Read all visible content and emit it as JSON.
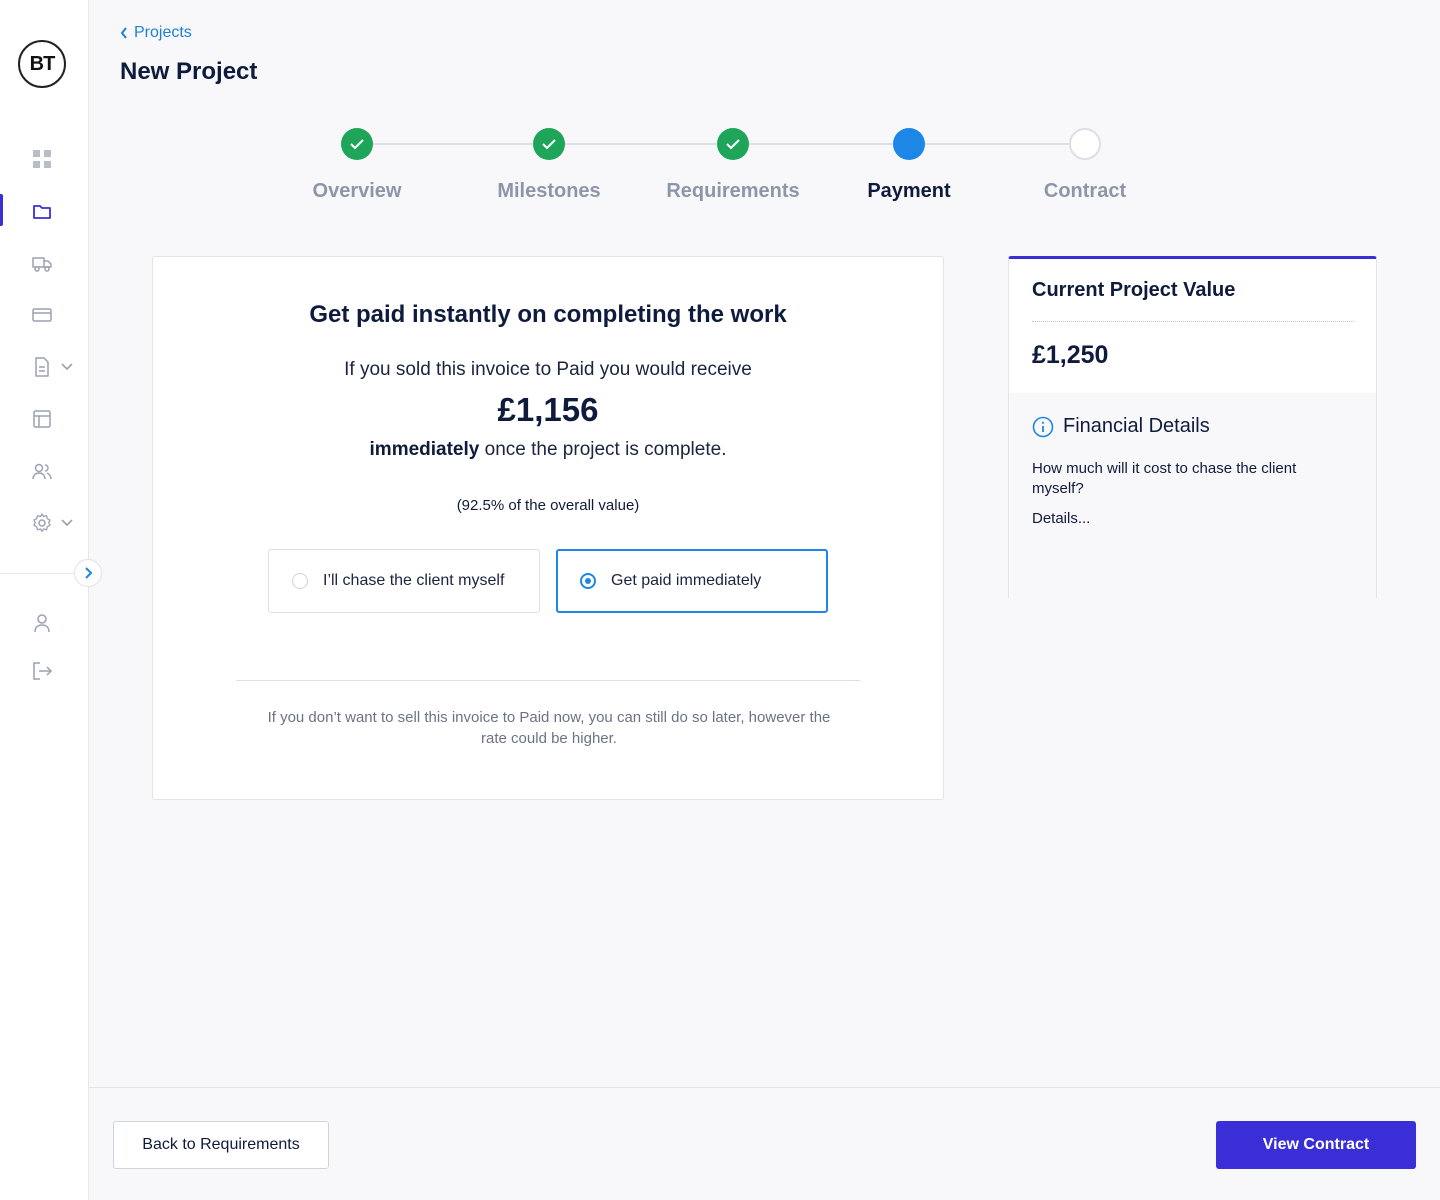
{
  "brand": {
    "logo_text": "BT",
    "accent": "#3a2fd6",
    "link": "#1d7fd6",
    "success": "#1fa55a",
    "progress": "#1d86e6"
  },
  "sidebar": {
    "items": [
      {
        "name": "dashboard",
        "icon": "grid-icon"
      },
      {
        "name": "projects",
        "icon": "folder-icon",
        "active": true
      },
      {
        "name": "delivery",
        "icon": "truck-icon"
      },
      {
        "name": "payments",
        "icon": "card-icon"
      },
      {
        "name": "documents",
        "icon": "document-icon",
        "expandable": true
      },
      {
        "name": "layout",
        "icon": "layout-icon"
      },
      {
        "name": "contacts",
        "icon": "users-icon"
      },
      {
        "name": "settings",
        "icon": "gear-icon",
        "expandable": true
      },
      {
        "name": "profile",
        "icon": "user-icon"
      },
      {
        "name": "logout",
        "icon": "logout-icon"
      }
    ]
  },
  "header": {
    "breadcrumb": "Projects",
    "title": "New Project"
  },
  "stepper": {
    "steps": [
      {
        "label": "Overview",
        "state": "done"
      },
      {
        "label": "Milestones",
        "state": "done"
      },
      {
        "label": "Requirements",
        "state": "done"
      },
      {
        "label": "Payment",
        "state": "current"
      },
      {
        "label": "Contract",
        "state": "todo"
      }
    ]
  },
  "payment_card": {
    "title": "Get paid instantly on completing the work",
    "line1": "If you sold this invoice to Paid you would receive",
    "amount": "£1,156",
    "line2_bold": "immediately",
    "line2_rest": " once the project is complete.",
    "percentage_note": "(92.5% of the overall value)",
    "options": [
      {
        "label": "I’ll chase the client myself",
        "selected": false
      },
      {
        "label": "Get paid immediately",
        "selected": true
      }
    ],
    "footnote": "If you don’t want to sell this invoice to Paid now, you can still do so later, however the rate could be higher."
  },
  "value_card": {
    "title": "Current Project Value",
    "value": "£1,250",
    "financial_title": "Financial Details",
    "question": "How much will it cost to chase the client myself?",
    "details_link": "Details..."
  },
  "footer": {
    "back_label": "Back to Requirements",
    "primary_label": "View Contract"
  }
}
